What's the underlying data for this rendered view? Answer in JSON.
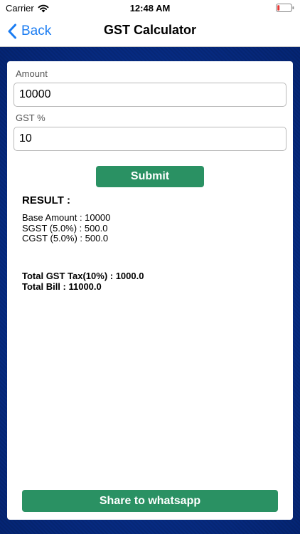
{
  "status_bar": {
    "carrier": "Carrier",
    "time": "12:48 AM",
    "battery_color": "#e53935"
  },
  "nav": {
    "back_label": "Back",
    "title": "GST Calculator",
    "accent_color": "#1a7cf2"
  },
  "form": {
    "amount_label": "Amount",
    "amount_value": "10000",
    "gst_label": "GST %",
    "gst_value": "10",
    "submit_label": "Submit",
    "button_color": "#2a9163"
  },
  "result": {
    "heading": "RESULT :",
    "lines": [
      "Base Amount : 10000",
      "SGST (5.0%) : 500.0",
      "CGST (5.0%) : 500.0"
    ],
    "totals": [
      "Total GST Tax(10%) : 1000.0",
      "Total Bill : 11000.0"
    ]
  },
  "share": {
    "label": "Share to whatsapp"
  },
  "icons": {
    "wifi": "wifi-icon",
    "battery": "battery-icon",
    "back": "chevron-left-icon"
  }
}
